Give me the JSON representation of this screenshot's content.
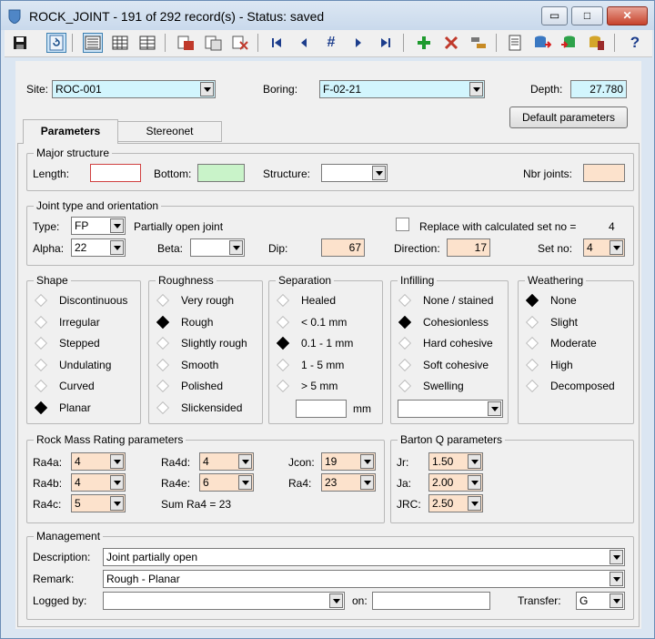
{
  "window": {
    "title": "ROCK_JOINT - 191 of 292 record(s) - Status: saved",
    "buttons": {
      "minimize": "▭",
      "maximize": "□",
      "close": "✕"
    }
  },
  "toolbar": {
    "icons": [
      "save-icon",
      "refresh-icon",
      "form-view-icon",
      "table-view-icon",
      "split-view-icon",
      "print-icon",
      "copy-records-icon",
      "delete-records-icon",
      "first-record-icon",
      "previous-record-icon",
      "goto-record-icon",
      "next-record-icon",
      "last-record-icon",
      "add-record-icon",
      "delete-record-icon",
      "filter-icon",
      "properties-icon",
      "database-export-icon",
      "database-import-icon",
      "database-book-icon",
      "help-icon"
    ],
    "goto_glyph": "#",
    "help_glyph": "?"
  },
  "header": {
    "site_label": "Site:",
    "site_value": "ROC-001",
    "boring_label": "Boring:",
    "boring_value": "F-02-21",
    "depth_label": "Depth:",
    "depth_value": "27.780",
    "default_button": "Default parameters"
  },
  "tabs": [
    {
      "label": "Parameters",
      "active": true
    },
    {
      "label": "Stereonet",
      "active": false
    }
  ],
  "major_structure": {
    "title": "Major structure",
    "length_label": "Length:",
    "length_value": "",
    "bottom_label": "Bottom:",
    "bottom_value": "",
    "structure_label": "Structure:",
    "structure_value": "",
    "nbr_joints_label": "Nbr joints:",
    "nbr_joints_value": ""
  },
  "joint_type": {
    "title": "Joint type and orientation",
    "type_label": "Type:",
    "type_value": "FP",
    "type_desc": "Partially open joint",
    "replace_label": "Replace with calculated set no =",
    "replace_value": "4",
    "alpha_label": "Alpha:",
    "alpha_value": "22",
    "beta_label": "Beta:",
    "beta_value": "",
    "dip_label": "Dip:",
    "dip_value": "67",
    "direction_label": "Direction:",
    "direction_value": "17",
    "setno_label": "Set no:",
    "setno_value": "4"
  },
  "shape": {
    "title": "Shape",
    "options": [
      "Discontinuous",
      "Irregular",
      "Stepped",
      "Undulating",
      "Curved",
      "Planar"
    ],
    "selected": 5
  },
  "roughness": {
    "title": "Roughness",
    "options": [
      "Very rough",
      "Rough",
      "Slightly rough",
      "Smooth",
      "Polished",
      "Slickensided"
    ],
    "selected": 1
  },
  "separation": {
    "title": "Separation",
    "options": [
      "Healed",
      "< 0.1 mm",
      "0.1 - 1 mm",
      "1 - 5 mm",
      "> 5 mm"
    ],
    "selected": 2,
    "mm_value": "",
    "mm_label": "mm"
  },
  "infilling": {
    "title": "Infilling",
    "options": [
      "None / stained",
      "Cohesionless",
      "Hard cohesive",
      "Soft cohesive",
      "Swelling"
    ],
    "selected": 1,
    "combo_value": ""
  },
  "weathering": {
    "title": "Weathering",
    "options": [
      "None",
      "Slight",
      "Moderate",
      "High",
      "Decomposed"
    ],
    "selected": 0
  },
  "rmr": {
    "title": "Rock Mass Rating parameters",
    "ra4a_label": "Ra4a:",
    "ra4a_value": "4",
    "ra4b_label": "Ra4b:",
    "ra4b_value": "4",
    "ra4c_label": "Ra4c:",
    "ra4c_value": "5",
    "ra4d_label": "Ra4d:",
    "ra4d_value": "4",
    "ra4e_label": "Ra4e:",
    "ra4e_value": "6",
    "jcon_label": "Jcon:",
    "jcon_value": "19",
    "ra4_label": "Ra4:",
    "ra4_value": "23",
    "sum_text": "Sum Ra4 = 23"
  },
  "barton": {
    "title": "Barton Q parameters",
    "jr_label": "Jr:",
    "jr_value": "1.50",
    "ja_label": "Ja:",
    "ja_value": "2.00",
    "jrc_label": "JRC:",
    "jrc_value": "2.50"
  },
  "management": {
    "title": "Management",
    "description_label": "Description:",
    "description_value": "Joint partially open",
    "remark_label": "Remark:",
    "remark_value": "Rough - Planar",
    "logged_label": "Logged by:",
    "logged_value": "",
    "on_label": "on:",
    "on_value": "",
    "transfer_label": "Transfer:",
    "transfer_value": "G"
  },
  "colors": {
    "cyan_field": "#d2f5fd",
    "peach_field": "#fce2cc",
    "green_field": "#c9f3c9",
    "title_bar": "#c9d9ec",
    "length_border": "#d04040"
  }
}
